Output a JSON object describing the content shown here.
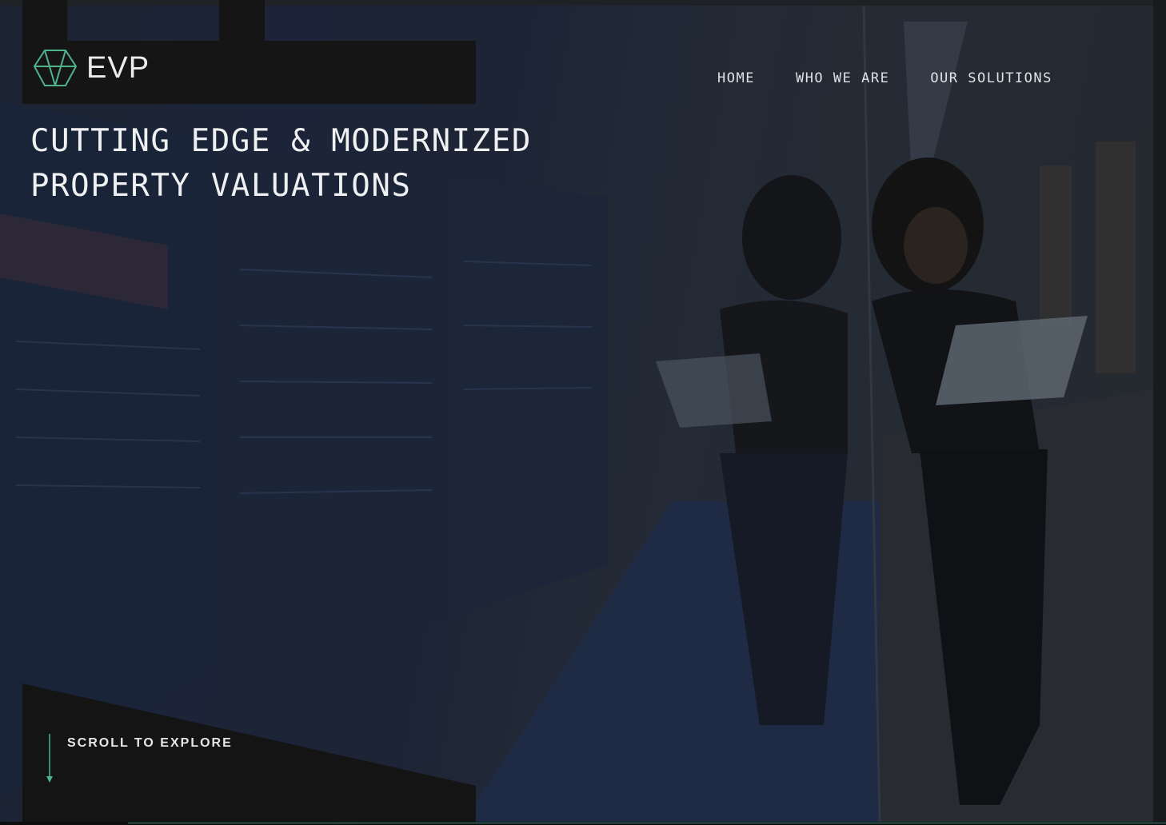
{
  "brand": {
    "name": "EVP",
    "logo_icon": "gem-outline-icon",
    "accent_color": "#4fb38c"
  },
  "nav": {
    "items": [
      {
        "label": "HOME"
      },
      {
        "label": "WHO WE ARE"
      },
      {
        "label": "OUR SOLUTIONS"
      }
    ]
  },
  "hero": {
    "headline_lines": [
      "CUTTING EDGE & MODERNIZED",
      "PROPERTY VALUATIONS"
    ],
    "scroll_label": "SCROLL TO EXPLORE",
    "scroll_icon": "arrow-down-icon"
  }
}
